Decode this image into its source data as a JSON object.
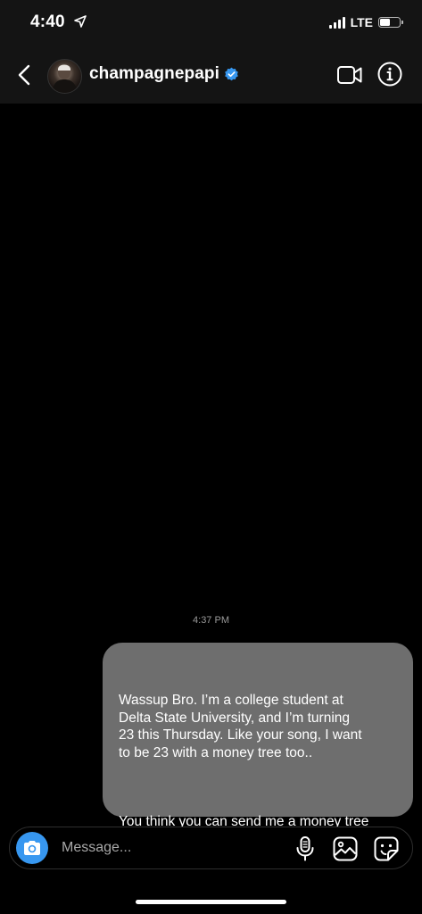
{
  "status_bar": {
    "time": "4:40",
    "network": "LTE",
    "battery_level": 0.5,
    "icons": [
      "location-arrow-icon",
      "signal-bars-icon",
      "battery-icon"
    ]
  },
  "header": {
    "username": "champagnepapi",
    "verified": true,
    "icons": [
      "back-arrow-icon",
      "video-camera-icon",
      "info-icon"
    ]
  },
  "conversation": {
    "timestamp": "4:37 PM",
    "messages": [
      {
        "sender": "me",
        "paragraphs": [
          "Wassup Bro. I’m a college student at\nDelta State University, and I’m turning\n23 this Thursday. Like your song, I want\nto be 23 with a money tree too..",
          "You think you can send me a money tree\n? Better yet, can you just send me the\ntree, I’ll put the money on it."
        ]
      }
    ]
  },
  "composer": {
    "placeholder": "Message...",
    "value": "",
    "icons": [
      "camera-icon",
      "microphone-icon",
      "gallery-icon",
      "sticker-icon"
    ]
  },
  "colors": {
    "background": "#000000",
    "header_background": "#141414",
    "bubble": "#6e6e6e",
    "camera_button": "#3797f0",
    "verified_badge": "#3797f0",
    "timestamp": "#9a9a9a"
  }
}
